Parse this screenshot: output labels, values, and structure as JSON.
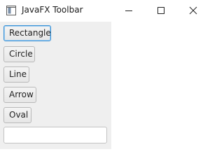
{
  "window": {
    "title": "JavaFX Toolbar"
  },
  "icons": {
    "app": "window-app-icon",
    "minimize": "minimize-icon",
    "maximize": "maximize-icon",
    "close": "close-icon"
  },
  "toolbar": {
    "buttons": [
      {
        "label": "Rectangle",
        "focused": true
      },
      {
        "label": "Circle"
      },
      {
        "label": "Line"
      },
      {
        "label": "Arrow"
      },
      {
        "label": "Oval"
      }
    ],
    "text_field": {
      "value": "",
      "placeholder": ""
    }
  },
  "colors": {
    "toolbar_bg": "#efefef",
    "focus_border": "#3c93d6"
  }
}
